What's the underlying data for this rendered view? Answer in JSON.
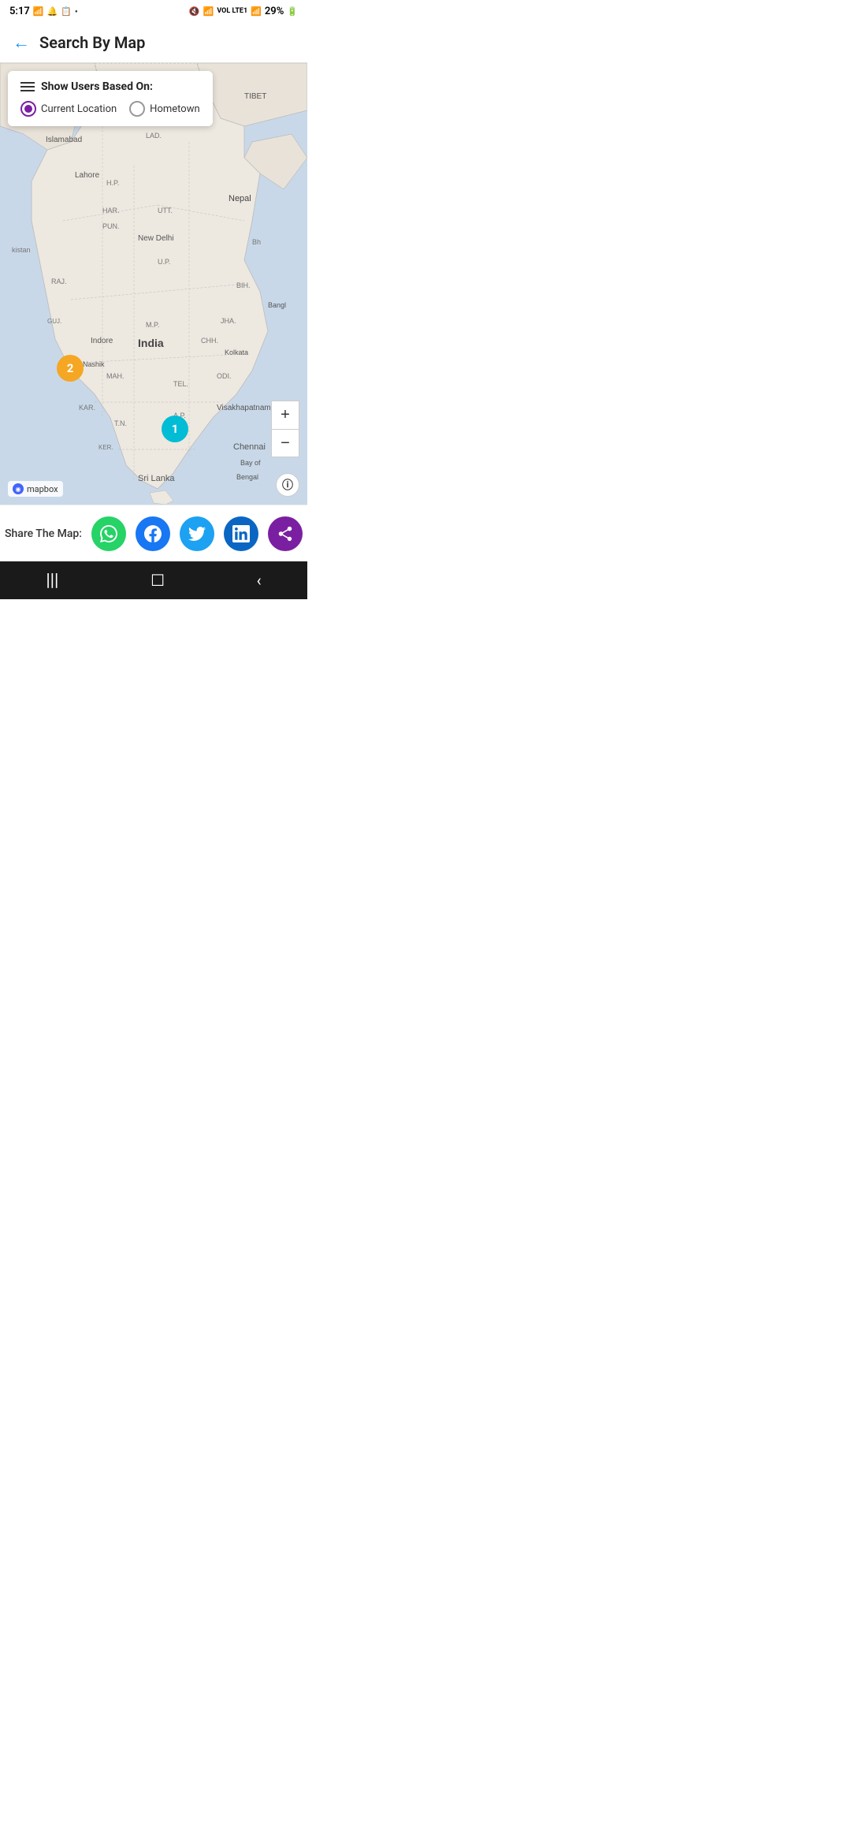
{
  "statusBar": {
    "time": "5:17",
    "batteryPercent": "29%"
  },
  "header": {
    "backLabel": "←",
    "title": "Search By Map"
  },
  "filter": {
    "title": "Show Users Based On:",
    "options": [
      {
        "id": "current",
        "label": "Current Location",
        "selected": true
      },
      {
        "id": "hometown",
        "label": "Hometown",
        "selected": false
      }
    ]
  },
  "mapControls": {
    "zoomIn": "+",
    "zoomOut": "−"
  },
  "markers": [
    {
      "id": "orange-cluster",
      "count": "2",
      "color": "#F5A623"
    },
    {
      "id": "cyan-cluster",
      "count": "1",
      "color": "#00BCD4"
    }
  ],
  "share": {
    "label": "Share The Map:",
    "buttons": [
      {
        "id": "whatsapp",
        "icon": "✔",
        "label": "WhatsApp",
        "color": "#25D366"
      },
      {
        "id": "facebook",
        "icon": "f",
        "label": "Facebook",
        "color": "#1877F2"
      },
      {
        "id": "twitter",
        "icon": "🐦",
        "label": "Twitter",
        "color": "#1DA1F2"
      },
      {
        "id": "linkedin",
        "icon": "in",
        "label": "LinkedIn",
        "color": "#0A66C2"
      },
      {
        "id": "other",
        "icon": "◉",
        "label": "Other",
        "color": "#7B1FA2"
      }
    ]
  },
  "mapboxLabel": "mapbox",
  "infoLabel": "ⓘ",
  "nav": {
    "items": [
      "|||",
      "☐",
      "‹"
    ]
  }
}
